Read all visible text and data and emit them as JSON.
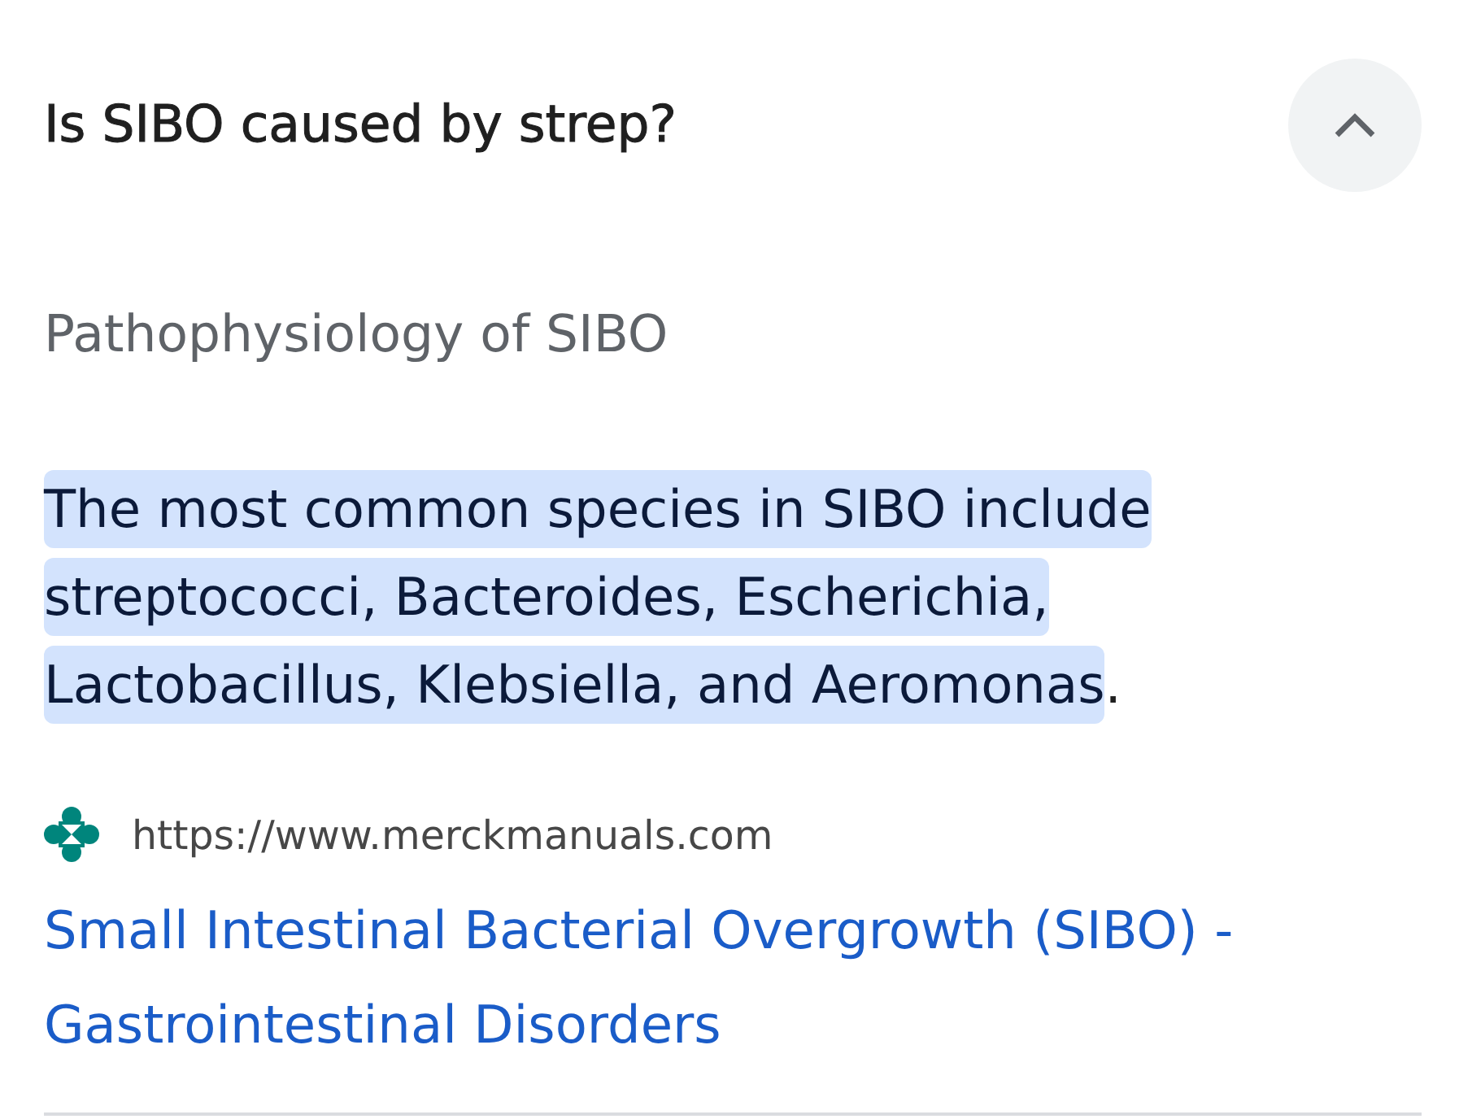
{
  "question": {
    "text": "Is SIBO caused by strep?",
    "expanded": true
  },
  "answer": {
    "heading": "Pathophysiology of SIBO",
    "snippet": [
      {
        "text": " The most common species in SIBO include streptococci, Bacteroides, Escherichia, Lactobacillus, Klebsiella, and Aeromonas",
        "highlighted": true
      },
      {
        "text": ".",
        "highlighted": false
      }
    ]
  },
  "source": {
    "url": "https://www.merckmanuals.com",
    "title": "Small Intestinal Bacterial Overgrowth (SIBO) - Gastrointestinal Disorders"
  }
}
